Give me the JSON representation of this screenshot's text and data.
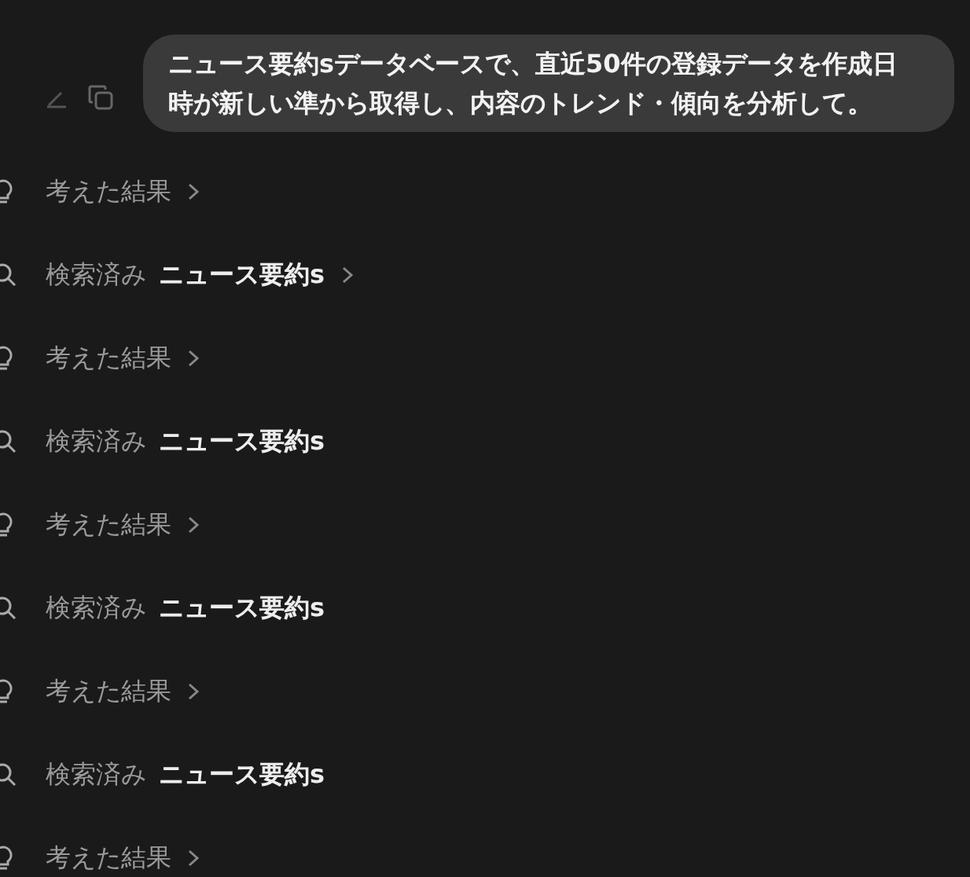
{
  "message": {
    "text": "ニュース要約sデータベースで、直近50件の登録データを作成日時が新しい準から取得し、内容のトレンド・傾向を分析して。"
  },
  "steps": [
    {
      "kind": "thought",
      "label": "考えた結果",
      "expandable": true
    },
    {
      "kind": "search",
      "label": "検索済み",
      "target": "ニュース要約s",
      "expandable": true
    },
    {
      "kind": "thought",
      "label": "考えた結果",
      "expandable": true
    },
    {
      "kind": "search",
      "label": "検索済み",
      "target": "ニュース要約s",
      "expandable": false
    },
    {
      "kind": "thought",
      "label": "考えた結果",
      "expandable": true
    },
    {
      "kind": "search",
      "label": "検索済み",
      "target": "ニュース要約s",
      "expandable": false
    },
    {
      "kind": "thought",
      "label": "考えた結果",
      "expandable": true
    },
    {
      "kind": "search",
      "label": "検索済み",
      "target": "ニュース要約s",
      "expandable": false
    },
    {
      "kind": "thought",
      "label": "考えた結果",
      "expandable": true
    }
  ]
}
